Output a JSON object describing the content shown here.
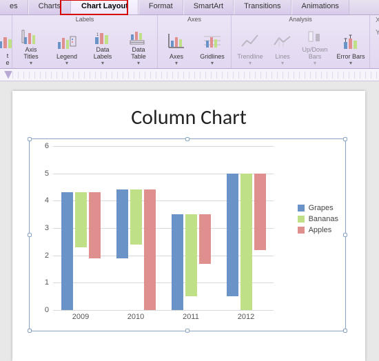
{
  "tabs": {
    "t0": "es",
    "t1": "Charts",
    "t2": "Chart Layout",
    "t3": "Format",
    "t4": "SmartArt",
    "t5": "Transitions",
    "t6": "Animations",
    "active_index": 2
  },
  "ribbon": {
    "groups": {
      "labels": {
        "title": "Labels",
        "axis_titles": "Axis\nTitles",
        "legend": "Legend",
        "data_labels": "Data\nLabels",
        "data_table": "Data\nTable"
      },
      "axes": {
        "title": "Axes",
        "axes_btn": "Axes",
        "gridlines": "Gridlines"
      },
      "analysis": {
        "title": "Analysis",
        "trendline": "Trendline",
        "lines": "Lines",
        "updown": "Up/Down\nBars",
        "errorbars": "Error Bars"
      },
      "coords": {
        "x": "X:",
        "y": "Y:"
      }
    }
  },
  "chart_title": "Column Chart",
  "chart_data": {
    "type": "bar",
    "categories": [
      "2009",
      "2010",
      "2011",
      "2012"
    ],
    "series": [
      {
        "name": "Grapes",
        "values": [
          4.3,
          2.5,
          3.5,
          4.5
        ],
        "color": "#6a94c7"
      },
      {
        "name": "Bananas",
        "values": [
          2.0,
          2.0,
          3.0,
          5.0
        ],
        "color": "#bfe086"
      },
      {
        "name": "Apples",
        "values": [
          2.4,
          4.4,
          1.8,
          2.8
        ],
        "color": "#e08f8f"
      }
    ],
    "ylim": [
      0,
      6
    ],
    "y_ticks": [
      0,
      1,
      2,
      3,
      4,
      5,
      6
    ],
    "title": "Column Chart",
    "xlabel": "",
    "ylabel": ""
  }
}
